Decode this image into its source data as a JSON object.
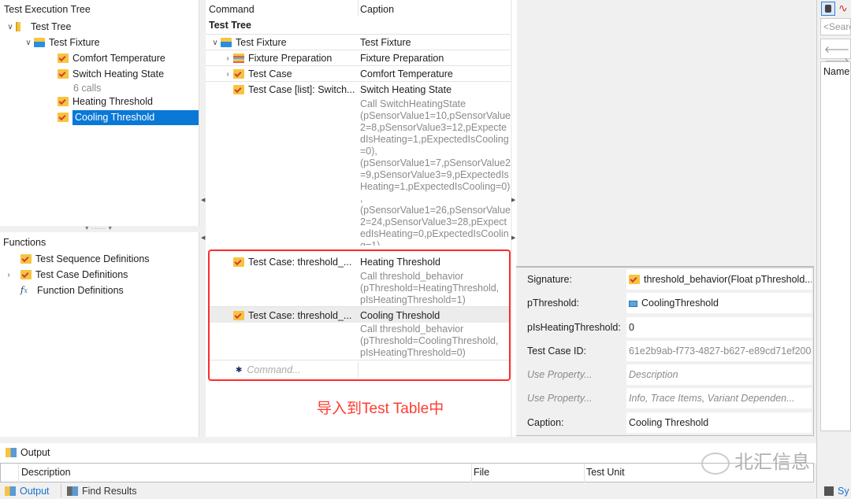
{
  "execution_tree": {
    "title": "Test Execution Tree",
    "items": [
      {
        "label": "Test Tree",
        "icon": "test-tree-icon"
      },
      {
        "label": "Test Fixture",
        "icon": "test-fixture-icon"
      },
      {
        "label": "Comfort Temperature",
        "icon": "test-case-icon"
      },
      {
        "label": "Switch Heating State",
        "icon": "test-case-list-icon",
        "sub": "6 calls"
      },
      {
        "label": "Heating Threshold",
        "icon": "test-case-icon"
      },
      {
        "label": "Cooling Threshold",
        "icon": "test-case-icon",
        "selected": true
      }
    ]
  },
  "functions": {
    "title": "Functions",
    "items": [
      {
        "label": "Test Sequence Definitions",
        "icon": "test-sequence-icon"
      },
      {
        "label": "Test Case Definitions",
        "icon": "test-case-definitions-icon"
      },
      {
        "label": "Function Definitions",
        "icon": "function-icon"
      }
    ]
  },
  "table": {
    "columns": [
      "Command",
      "Caption"
    ],
    "group": "Test Tree",
    "rows": [
      {
        "command": "Test Fixture",
        "caption": "Test Fixture"
      },
      {
        "command": "Fixture Preparation",
        "caption": "Fixture Preparation"
      },
      {
        "command": "Test Case",
        "caption": "Comfort Temperature"
      },
      {
        "command": "Test Case [list]: Switch...",
        "caption": "Switch Heating State",
        "desc": [
          "Call SwitchHeatingState",
          "(pSensorValue1=10,pSensorValue",
          "2=8,pSensorValue3=12,pExpecte",
          "dIsHeating=1,pExpectedIsCooling",
          "=0),",
          "(pSensorValue1=7,pSensorValue2",
          "=9,pSensorValue3=9,pExpectedIs",
          "Heating=1,pExpectedIsCooling=0)",
          ",",
          "(pSensorValue1=26,pSensorValue",
          "2=24,pSensorValue3=28,pExpect",
          "edIsHeating=0,pExpectedIsCoolin",
          "g=1)"
        ]
      },
      {
        "command": "Test Case: threshold_...",
        "caption": "Heating Threshold",
        "desc": [
          "Call threshold_behavior",
          "(pThreshold=HeatingThreshold,",
          "pIsHeatingThreshold=1)"
        ]
      },
      {
        "command": "Test Case: threshold_...",
        "caption": "Cooling Threshold",
        "desc": [
          "Call threshold_behavior",
          "(pThreshold=CoolingThreshold,",
          "pIsHeatingThreshold=0)"
        ]
      }
    ],
    "new_command_placeholder": "Command..."
  },
  "annotation": {
    "text": "导入到Test Table中",
    "color": "#ff3b30"
  },
  "properties": [
    {
      "label": "Signature:",
      "value": "threshold_behavior(Float pThreshold..."
    },
    {
      "label": "pThreshold:",
      "value": "CoolingThreshold"
    },
    {
      "label": "pIsHeatingThreshold:",
      "value": "0"
    },
    {
      "label": "Test Case ID:",
      "value": "61e2b9ab-f773-4827-b627-e89cd71ef200"
    },
    {
      "label": "Use Property...",
      "value": "Description"
    },
    {
      "label": "Use Property...",
      "value": "Info, Trace Items, Variant Dependen..."
    },
    {
      "label": "Caption:",
      "value": "Cooling Threshold"
    }
  ],
  "right_panel": {
    "search_placeholder": "<Search",
    "column": "Name"
  },
  "output": {
    "title": "Output",
    "columns": [
      "Description",
      "File",
      "Test Unit"
    ],
    "tabs": [
      "Output",
      "Find Results"
    ],
    "right_tab": "Sy"
  },
  "watermark": "北汇信息"
}
